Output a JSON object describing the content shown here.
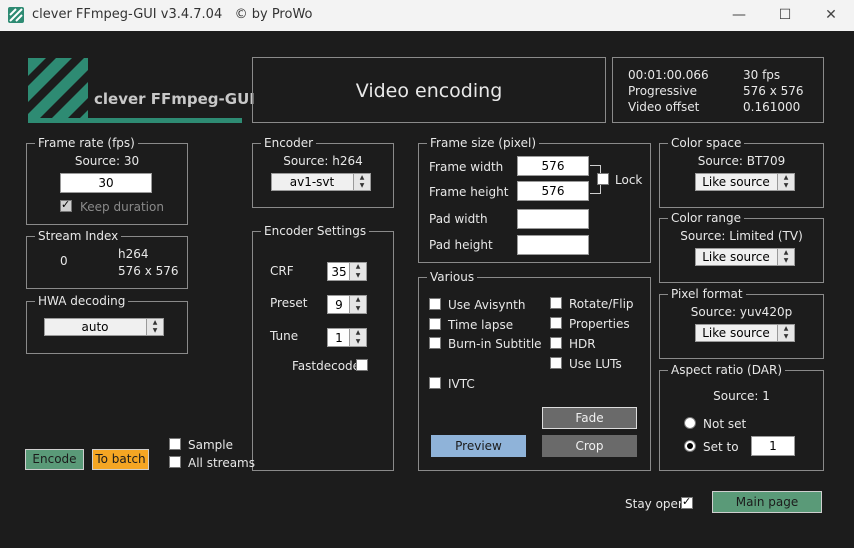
{
  "window": {
    "title": "clever FFmpeg-GUI v3.4.7.04   © by ProWo",
    "minimize": "—",
    "maximize": "☐",
    "close": "✕"
  },
  "logo": {
    "text": "clever FFmpeg-GUI"
  },
  "header": {
    "title": "Video encoding"
  },
  "info": {
    "duration": "00:01:00.066",
    "fps": "30 fps",
    "scan": "Progressive",
    "resolution": "576 x 576",
    "offset_label": "Video offset",
    "offset_value": "0.161000"
  },
  "frame_rate": {
    "title": "Frame rate (fps)",
    "source": "Source: 30",
    "value": "30",
    "keep_duration": "Keep duration",
    "keep_duration_checked": true
  },
  "stream_index": {
    "title": "Stream Index",
    "index": "0",
    "codec": "h264",
    "size": "576 x 576"
  },
  "hwa": {
    "title": "HWA decoding",
    "value": "auto"
  },
  "encoder": {
    "title": "Encoder",
    "source": "Source: h264",
    "value": "av1-svt"
  },
  "encoder_settings": {
    "title": "Encoder Settings",
    "crf_label": "CRF",
    "crf_value": "35",
    "preset_label": "Preset",
    "preset_value": "9",
    "tune_label": "Tune",
    "tune_value": "1",
    "fastdecode_label": "Fastdecode",
    "fastdecode_checked": false
  },
  "frame_size": {
    "title": "Frame size (pixel)",
    "width_label": "Frame width",
    "width_value": "576",
    "height_label": "Frame height",
    "height_value": "576",
    "lock_label": "Lock",
    "lock_checked": false,
    "pad_width_label": "Pad width",
    "pad_width_value": "",
    "pad_height_label": "Pad height",
    "pad_height_value": ""
  },
  "various": {
    "title": "Various",
    "left": [
      "Use Avisynth",
      "Time lapse",
      "Burn-in Subtitle"
    ],
    "right": [
      "Rotate/Flip",
      "Properties",
      "HDR",
      "Use LUTs"
    ],
    "ivtc": "IVTC",
    "fade_button": "Fade",
    "preview_button": "Preview",
    "crop_button": "Crop"
  },
  "color_space": {
    "title": "Color space",
    "source": "Source: BT709",
    "value": "Like source"
  },
  "color_range": {
    "title": "Color range",
    "source": "Source: Limited (TV)",
    "value": "Like source"
  },
  "pixel_format": {
    "title": "Pixel format",
    "source": "Source: yuv420p",
    "value": "Like source"
  },
  "aspect_ratio": {
    "title": "Aspect ratio (DAR)",
    "source": "Source: 1",
    "not_set": "Not set",
    "set_to": "Set to",
    "set_to_value": "1",
    "selected": "set_to"
  },
  "bottom": {
    "encode": "Encode",
    "to_batch": "To batch",
    "sample": "Sample",
    "all_streams": "All streams",
    "stay_open": "Stay open",
    "stay_open_checked": true,
    "main_page": "Main page"
  },
  "colors": {
    "accent_green": "#5a9a78",
    "accent_orange": "#f5a623",
    "preview_blue": "#8fb3d9",
    "crop_gray": "#6a6a6a",
    "logo_green": "#2e8b73"
  }
}
